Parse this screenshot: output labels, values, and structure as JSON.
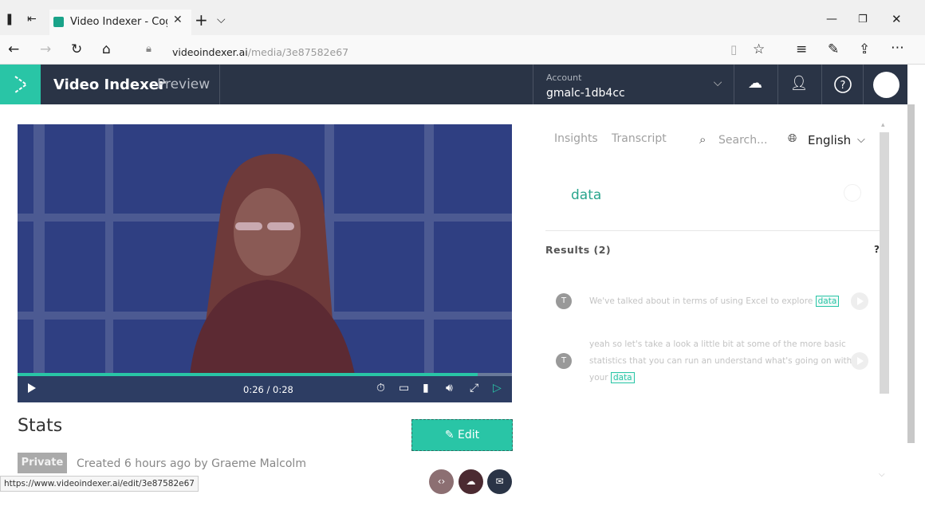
{
  "browser": {
    "tab_title": "Video Indexer - Cogniti",
    "url_domain": "videoindexer.ai",
    "url_path": "/media/3e87582e67",
    "status_url": "https://www.videoindexer.ai/edit/3e87582e67"
  },
  "header": {
    "app_name": "Video Indexer",
    "badge": "Preview",
    "account_label": "Account",
    "account_name": "gmalc-1db4cc"
  },
  "player": {
    "time": "0:26 / 0:28",
    "progress": 0.93
  },
  "video": {
    "title": "Stats",
    "privacy": "Private",
    "created": "Created 6 hours ago by Graeme Malcolm",
    "edit_label": "Edit"
  },
  "panel": {
    "tabs": [
      "Insights",
      "Transcript"
    ],
    "search_placeholder": "Search...",
    "language": "English",
    "query": "data",
    "results_label": "Results (2)",
    "help": "?",
    "results": [
      {
        "icon": "T",
        "before": "We've talked about in terms of using Excel to explore",
        "highlight": "data",
        "line2": "",
        "line3_before": ""
      },
      {
        "icon": "T",
        "before": "yeah so let's take a look a little bit at some of the more basic",
        "line2": "statistics that you can run an understand what's going on with",
        "line3_before": "your",
        "highlight": "data"
      }
    ]
  },
  "colors": {
    "accent": "#29c5a6",
    "header_bg": "#2a3446",
    "video_bg": "#2f3f82"
  }
}
